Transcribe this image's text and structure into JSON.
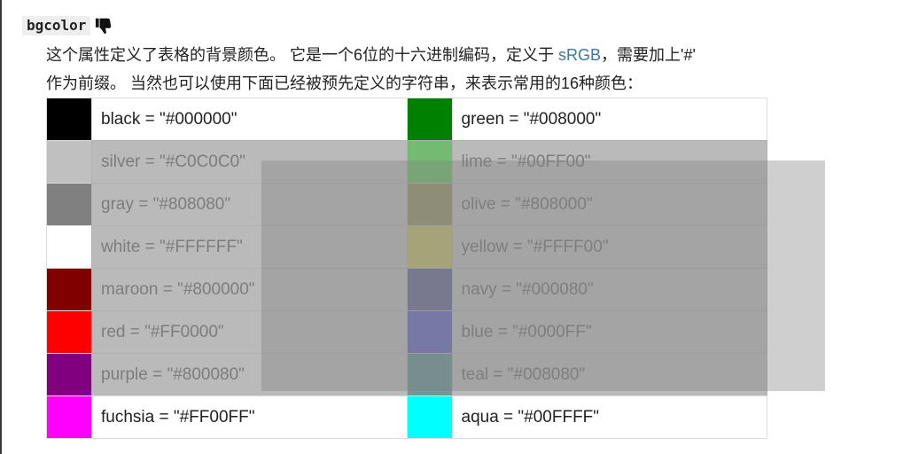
{
  "attribute": {
    "name": "bgcolor",
    "icon": "thumbs-down-icon"
  },
  "description": {
    "line1_before_link": "这个属性定义了表格的背景颜色。 它是一个6位的十六进制编码，定义于 ",
    "link": "sRGB",
    "line1_after_link": "，需要加上'#'",
    "line2": "作为前缀。 当然也可以使用下面已经被预先定义的字符串，来表示常用的16种颜色："
  },
  "colors": [
    [
      {
        "label": "black = \"#000000\"",
        "color": "#000000"
      },
      {
        "label": "green = \"#008000\"",
        "color": "#008000"
      }
    ],
    [
      {
        "label": "silver = \"#C0C0C0\"",
        "color": "#C0C0C0"
      },
      {
        "label": "lime = \"#00FF00\"",
        "color": "#00FF00"
      }
    ],
    [
      {
        "label": "gray = \"#808080\"",
        "color": "#808080"
      },
      {
        "label": "olive = \"#808000\"",
        "color": "#808000"
      }
    ],
    [
      {
        "label": "white = \"#FFFFFF\"",
        "color": "#FFFFFF"
      },
      {
        "label": "yellow = \"#FFFF00\"",
        "color": "#FFFF00"
      }
    ],
    [
      {
        "label": "maroon = \"#800000\"",
        "color": "#800000"
      },
      {
        "label": "navy = \"#000080\"",
        "color": "#000080"
      }
    ],
    [
      {
        "label": "red = \"#FF0000\"",
        "color": "#FF0000"
      },
      {
        "label": "blue = \"#0000FF\"",
        "color": "#0000FF"
      }
    ],
    [
      {
        "label": "purple = \"#800080\"",
        "color": "#800080"
      },
      {
        "label": "teal = \"#008080\"",
        "color": "#008080"
      }
    ],
    [
      {
        "label": "fuchsia = \"#FF00FF\"",
        "color": "#FF00FF"
      },
      {
        "label": "aqua = \"#00FFFF\"",
        "color": "#00FFFF"
      }
    ]
  ]
}
